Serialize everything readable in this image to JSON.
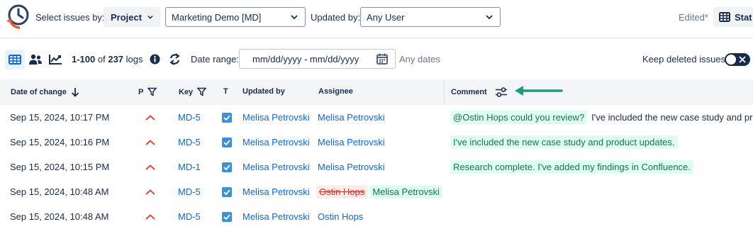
{
  "top_bar": {
    "select_issues_label": "Select issues by:",
    "project_button": "Project",
    "project_value": "Marketing Demo [MD]",
    "updated_by_label": "Updated by:",
    "updated_by_value": "Any User",
    "edited_label": "Edited*",
    "stats_button": "Stat"
  },
  "toolbar": {
    "range": "1-100",
    "of_label": "of",
    "total": "237",
    "logs_label": "logs",
    "date_range_label": "Date range:",
    "date_range_placeholder": "mm/dd/yyyy - mm/dd/yyyy",
    "any_dates": "Any dates",
    "keep_deleted_label": "Keep deleted issues"
  },
  "table": {
    "headers": {
      "date": "Date of change",
      "priority": "P",
      "key": "Key",
      "type": "T",
      "updated_by": "Updated by",
      "assignee": "Assignee",
      "comment": "Comment"
    },
    "rows": [
      {
        "date": "Sep 15, 2024, 10:17 PM",
        "key": "MD-5",
        "updated_by": "Melisa Petrovski",
        "assignee": "Melisa Petrovski",
        "comment_mention": "@Ostin Hops could you review?",
        "comment_text": "I've included the new case study and produ"
      },
      {
        "date": "Sep 15, 2024, 10:16 PM",
        "key": "MD-5",
        "updated_by": "Melisa Petrovski",
        "assignee": "Melisa Petrovski",
        "comment_added": "I've included the new case study and product updates."
      },
      {
        "date": "Sep 15, 2024, 10:15 PM",
        "key": "MD-1",
        "updated_by": "Melisa Petrovski",
        "assignee": "Melisa Petrovski",
        "comment_added": "Research complete. I've added my findings in Confluence."
      },
      {
        "date": "Sep 15, 2024, 10:48 AM",
        "key": "MD-5",
        "updated_by": "Melisa Petrovski",
        "assignee_old": "Ostin Hops",
        "assignee_new": "Melisa Petrovski"
      },
      {
        "date": "Sep 15, 2024, 10:48 AM",
        "key": "MD-5",
        "updated_by": "Melisa Petrovski",
        "assignee": "Ostin Hops"
      }
    ]
  },
  "colors": {
    "accent_blue": "#0c66e4",
    "added_bg": "#dcfff1",
    "added_text": "#216e4e",
    "removed_bg": "#ffeceb",
    "removed_text": "#c9372c",
    "priority_red": "#e2483d",
    "arrow_green": "#1f9c77"
  },
  "icons": [
    "clock-logo-icon",
    "chevron-down-icon",
    "grid-view-icon",
    "people-icon",
    "chart-icon",
    "info-icon",
    "refresh-icon",
    "calendar-icon",
    "sort-down-icon",
    "filter-icon",
    "sliders-icon",
    "arrow-left-icon",
    "priority-high-icon",
    "checkbox-icon",
    "table-icon"
  ]
}
